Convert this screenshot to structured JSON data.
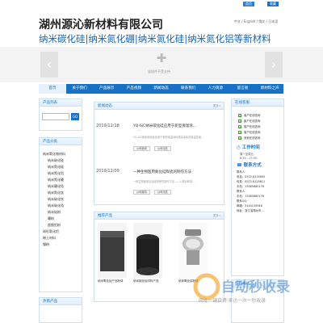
{
  "topbar": {
    "home_label": "首页",
    "favorite_label": "收藏"
  },
  "header": {
    "company_name": "湖州源沁新材料有限公司",
    "slogan": "纳米碳化硅|纳米氮化硼|纳米氮化硅|纳米氮化铝等新材料",
    "languages": "中文 / English / 俄文 / 日本语"
  },
  "banner": {
    "plugin_note": "该插件不受支持",
    "prev_arrow": "‹",
    "next_arrow": "›"
  },
  "nav": {
    "items": [
      "首页",
      "关于我们",
      "产品展示",
      "产品视频",
      "新闻动态",
      "联系我们",
      "人力资源",
      "留言板",
      "新材料之声"
    ]
  },
  "sidebar": {
    "product_list_title": "产品列表",
    "search_button": "GO",
    "categories_title": "产品分类",
    "categories": [
      {
        "label": "纳米氧化物材料",
        "sub": false
      },
      {
        "label": "纳米碳化硅",
        "sub": true
      },
      {
        "label": "纳米氮化硅",
        "sub": true
      },
      {
        "label": "纳米氮化铝",
        "sub": true
      },
      {
        "label": "纳米氮化硼",
        "sub": true
      },
      {
        "label": "纳米硼化锆",
        "sub": true
      },
      {
        "label": "纳米氮化钛",
        "sub": true
      },
      {
        "label": "纳米碳化钛",
        "sub": true
      },
      {
        "label": "纳米碳化锆",
        "sub": true
      },
      {
        "label": "纳米硅粉",
        "sub": true
      },
      {
        "label": "硼粉",
        "sub": true
      },
      {
        "label": "超细铝粉",
        "sub": true
      },
      {
        "label": "球形氧化铝",
        "sub": false
      },
      {
        "label": "稀土材料",
        "sub": false
      },
      {
        "label": "镍粉",
        "sub": false
      }
    ],
    "hot_title": "热销产品"
  },
  "news": {
    "title": "新闻动态",
    "more": "更多»",
    "items": [
      {
        "date": "2019/12/18",
        "title": "YQ-SiC纳米碳化硅应用于新型保温涂…",
        "desc": "YQ-SiC纳米碳化硅应用于新型保温涂料提高涂料的保温性能…",
        "btn1": "公司新闻",
        "btn2": "公司动态"
      },
      {
        "date": "2019/12/09",
        "title": "一种生物医用氮化硅陶瓷的制作方法",
        "desc": "一种生物医用氮化硅陶瓷的制作方法——1.原料称量…",
        "btn1": "公司新闻",
        "btn2": "公司动态"
      }
    ]
  },
  "products": {
    "title": "推荐产品",
    "more": "更多»",
    "items": [
      {
        "caption": "纳米氧化钛产品粉体"
      },
      {
        "caption": "纳米碳化硅材料产品"
      },
      {
        "caption": "纳米氧化铝粉体"
      }
    ]
  },
  "right": {
    "service_title": "在线客服",
    "services": [
      "客户在线咨询",
      "客户在线咨询",
      "客户在线咨询",
      "客户在线咨询",
      "其他在线咨询"
    ],
    "worktime_title": "工作时间",
    "worktime": [
      "周一至周五：",
      "8:30 - 17:30"
    ],
    "contact_title": "联系方式",
    "contact_lines": [
      "联系人：",
      "电话：0572-6125600",
      "传真：0572-6125611",
      "手机：13365680176",
      "联系人：",
      "手机：13365680176",
      "联系QQ：",
      "邮箱：3144135946",
      "地址：浙江省湖州市…"
    ],
    "scan_title": "扫码关注"
  },
  "watermark": {
    "title": "自动秒收录",
    "subtitle": "网址一键获得·来访一次一秒收录"
  },
  "colors": {
    "nav_blue": "#1772c5",
    "accent_orange": "#f29400"
  }
}
